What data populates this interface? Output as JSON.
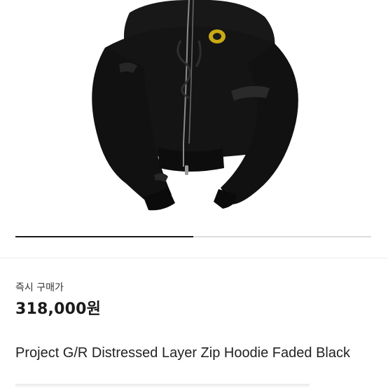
{
  "product": {
    "image_alt": "black distressed zip hoodie product photo",
    "image_count": 2,
    "active_image_index": 1,
    "price_label": "즉시 구매가",
    "price": "318,000원",
    "title": "Project G/R Distressed Layer Zip Hoodie Faded Black"
  },
  "colors": {
    "indicator_active": "#1a1a1a",
    "indicator_track": "#dddddd",
    "garment": "#141414"
  }
}
